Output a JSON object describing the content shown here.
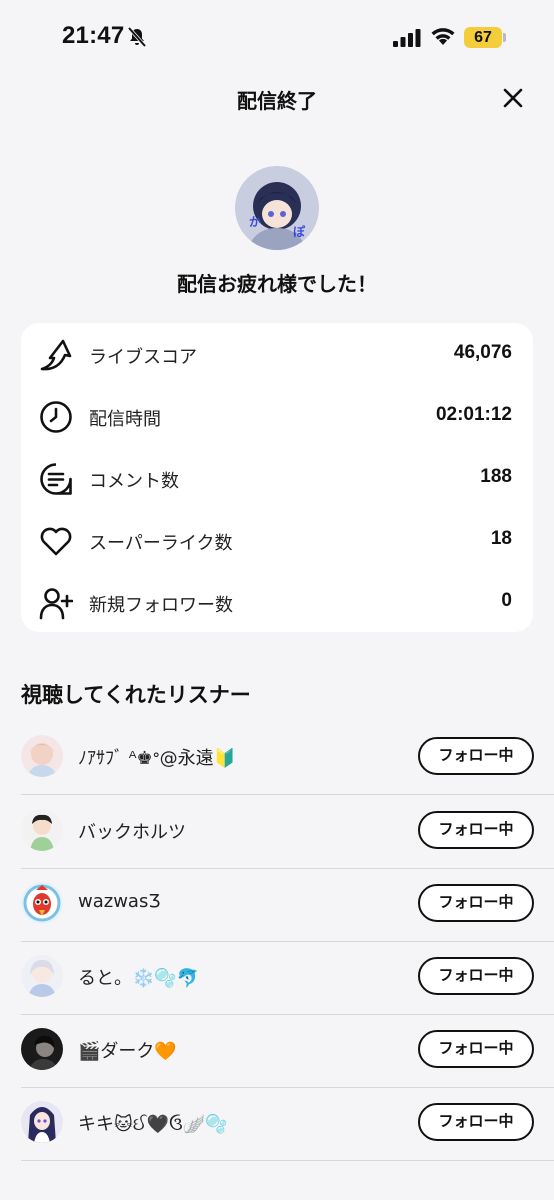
{
  "status_bar": {
    "time": "21:47",
    "battery": "67"
  },
  "header": {
    "title": "配信終了"
  },
  "message": "配信お疲れ様でした！",
  "stats": [
    {
      "label": "ライブスコア",
      "value": "46,076",
      "icon": "score-arrow-icon"
    },
    {
      "label": "配信時間",
      "value": "02:01:12",
      "icon": "clock-icon"
    },
    {
      "label": "コメント数",
      "value": "188",
      "icon": "comment-icon"
    },
    {
      "label": "スーパーライク数",
      "value": "18",
      "icon": "heart-icon"
    },
    {
      "label": "新規フォロワー数",
      "value": "0",
      "icon": "add-user-icon"
    }
  ],
  "listeners_title": "視聴してくれたリスナー",
  "listeners": [
    {
      "name": "ﾉｱｻﾌﾞ ᴬ♚ᐤ@永遠🔰",
      "button": "フォロー中"
    },
    {
      "name": "バックホルツ",
      "button": "フォロー中"
    },
    {
      "name": "wazwasƷ",
      "button": "フォロー中"
    },
    {
      "name": "ると。❄️🫧🐬",
      "button": "フォロー中"
    },
    {
      "name": "🎬ダーク🧡",
      "button": "フォロー中"
    },
    {
      "name": "キキ🐱ઈ🖤ઉ🪽🫧",
      "button": "フォロー中"
    }
  ],
  "colors": {
    "background": "#f5f5f7",
    "card": "#ffffff",
    "battery": "#f3cd3a",
    "text": "#111111"
  }
}
